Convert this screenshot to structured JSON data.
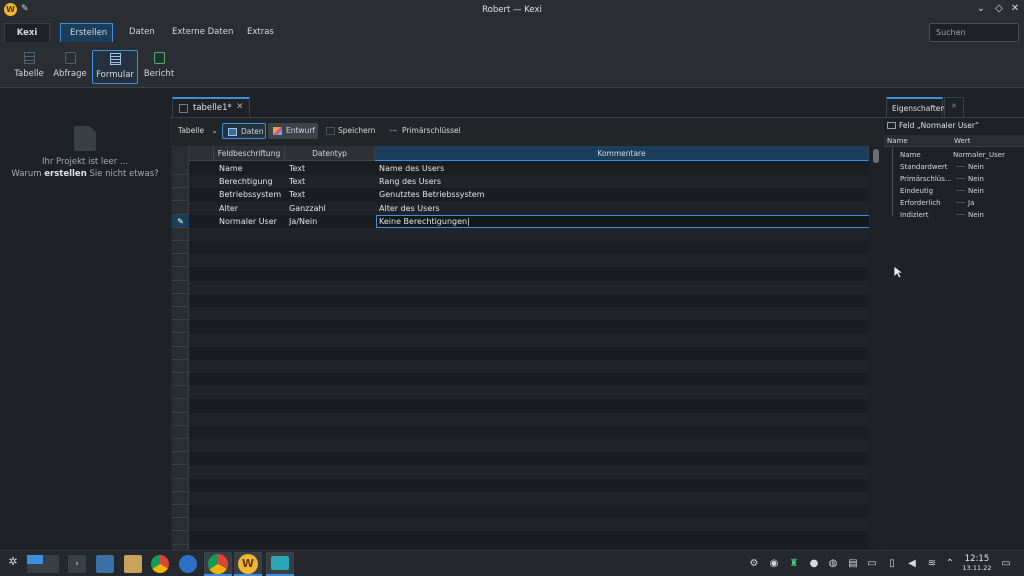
{
  "window": {
    "title": "Robert — Kexi"
  },
  "ribbon_tabs": [
    {
      "label": "Kexi"
    },
    {
      "label": "Erstellen"
    },
    {
      "label": "Daten"
    },
    {
      "label": "Externe Daten"
    },
    {
      "label": "Extras"
    }
  ],
  "search": {
    "placeholder": "Suchen"
  },
  "ribbon_buttons": [
    {
      "label": "Tabelle"
    },
    {
      "label": "Abfrage"
    },
    {
      "label": "Formular"
    },
    {
      "label": "Bericht"
    }
  ],
  "project_panel": {
    "line1": "Ihr Projekt ist leer ...",
    "line2_pre": "Warum ",
    "line2_bold": "erstellen",
    "line2_post": " Sie nicht etwas?"
  },
  "document_tab": {
    "label": "tabelle1*"
  },
  "designer_toolbar": {
    "view_select": "Tabelle",
    "data_label": "Daten",
    "design_label": "Entwurf",
    "save_label": "Speichern",
    "primary_key_label": "Primärschlüssel"
  },
  "grid": {
    "columns": [
      "Feldbeschriftung",
      "Datentyp",
      "Kommentare"
    ],
    "rows": [
      {
        "name": "Name",
        "type": "Text",
        "comment": "Name des Users"
      },
      {
        "name": "Berechtigung",
        "type": "Text",
        "comment": "Rang des Users"
      },
      {
        "name": "Betriebssystem",
        "type": "Text",
        "comment": "Genutztes Betriebssystem"
      },
      {
        "name": "Alter",
        "type": "Ganzzahl",
        "comment": "Alter des Users"
      },
      {
        "name": "Normaler User",
        "type": "Ja/Nein",
        "comment": "Keine Berechtigungen"
      }
    ]
  },
  "properties": {
    "tab_label": "Eigenschaften",
    "field_label": "Feld „Normaler User“",
    "col_name": "Name",
    "col_value": "Wert",
    "items": [
      {
        "key": "Name",
        "value": "Normaler_User"
      },
      {
        "key": "Standardwert",
        "value": "Nein"
      },
      {
        "key": "Primärschlüs...",
        "value": "Nein"
      },
      {
        "key": "Eindeutig",
        "value": "Nein"
      },
      {
        "key": "Erforderlich",
        "value": "Ja"
      },
      {
        "key": "Indiziert",
        "value": "Nein"
      }
    ]
  },
  "taskbar": {
    "time": "12:15",
    "date": "13.11.22"
  },
  "colors": {
    "accent": "#3d8ee0",
    "background": "#1e2125",
    "panel": "#2a2e32"
  }
}
